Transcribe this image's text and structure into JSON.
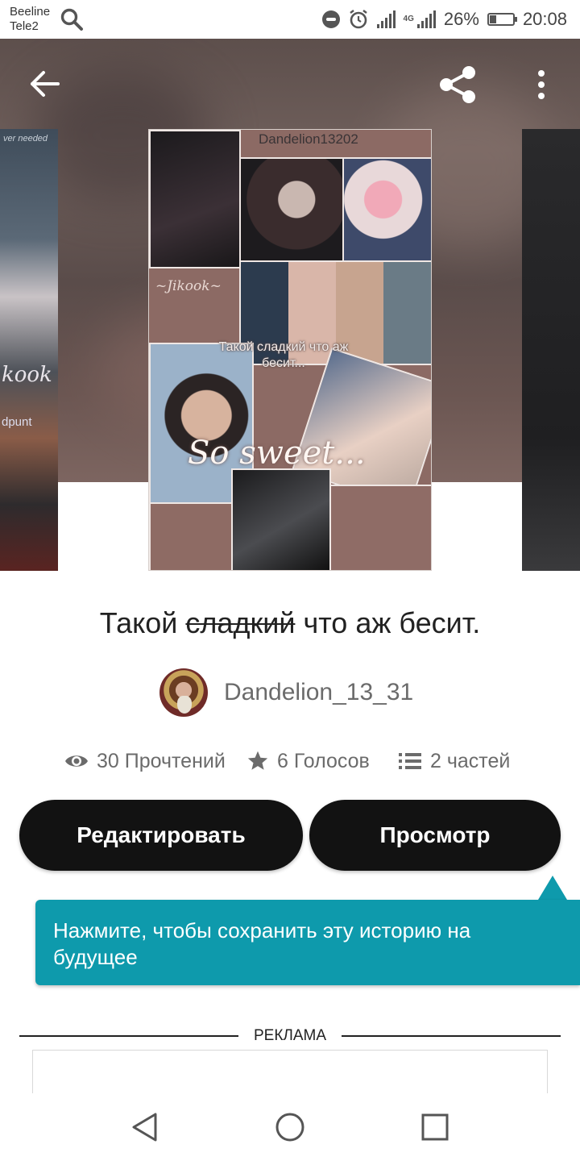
{
  "status_bar": {
    "carrier_1": "Beeline",
    "carrier_2": "Tele2",
    "network_label": "4G",
    "battery_percent": "26%",
    "battery_level": 0.26,
    "time": "20:08",
    "icons": [
      "search-icon",
      "do-not-disturb-icon",
      "alarm-icon",
      "signal-icon",
      "battery-icon"
    ]
  },
  "header": {
    "icons": [
      "back-arrow-icon",
      "share-icon",
      "more-vertical-icon"
    ]
  },
  "cover": {
    "watermark": "Dandelion13202",
    "tag": "~Jikook~",
    "caption": "Такой сладкий что аж бесит...",
    "script_text": "So sweet..."
  },
  "side_cover_left": {
    "text_1": "ver needed",
    "text_2": "kook",
    "text_3": "dpunt"
  },
  "story": {
    "title_start": "Такой",
    "title_struck": "сладкий",
    "title_end": "что аж бесит."
  },
  "author": {
    "name": "Dandelion_13_31"
  },
  "stats": {
    "reads": "30 Прочтений",
    "votes": "6 Голосов",
    "parts": "2 частей"
  },
  "buttons": {
    "edit_label": "Редактировать",
    "view_label": "Просмотр"
  },
  "tooltip": {
    "text": "Нажмите, чтобы сохранить эту историю на будущее"
  },
  "ad": {
    "label": "РЕКЛАМА"
  },
  "nav_bar": {
    "icons": [
      "nav-back-icon",
      "nav-home-icon",
      "nav-recents-icon"
    ]
  },
  "colors": {
    "button_bg": "#121212",
    "tooltip_bg": "#0e9aac",
    "text_secondary": "#6b6b6b",
    "title_text": "#222222"
  }
}
